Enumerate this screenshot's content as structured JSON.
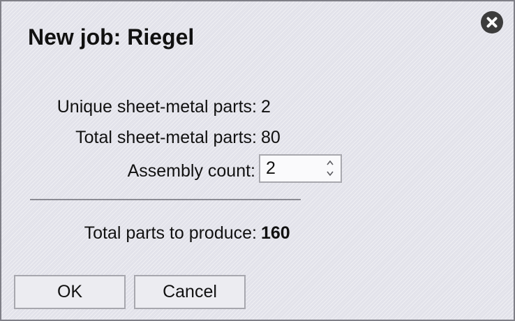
{
  "dialog": {
    "title": "New job: Riegel"
  },
  "stats": {
    "unique_label": "Unique sheet-metal parts:",
    "unique_value": "2",
    "total_label": "Total sheet-metal parts:",
    "total_value": "80",
    "assembly_label": "Assembly count:",
    "assembly_value": "2",
    "result_label": "Total parts to produce:",
    "result_value": "160"
  },
  "buttons": {
    "ok_label": "OK",
    "cancel_label": "Cancel"
  },
  "icons": {
    "close": "close-icon",
    "spin_up": "chevron-up-icon",
    "spin_down": "chevron-down-icon"
  },
  "colors": {
    "dialog_background": "#e2e2ea",
    "close_button": "#3c3c3c",
    "text": "#111111"
  }
}
